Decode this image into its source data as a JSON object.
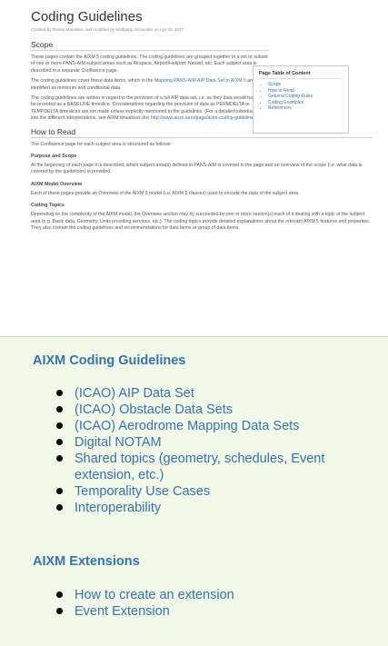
{
  "thumbnail": {
    "title": "Coding Guidelines",
    "meta": "Created by Rainer Mannsen, last modified by Wolfgang Schneider on Apr 26, 2017",
    "scope_heading": "Scope",
    "scope_p1": "These pages contain the AIXM 5 coding guidelines. The coding guidelines are grouped together in a set or subset of one or more PANS-AIM subject areas such as Airspace, Airport/Heliport, Navaid, etc. Each subject area is described in a separate Confluence page.",
    "scope_p2_pre": "The coding guidelines cover these data items, which in the ",
    "scope_p2_link": "Mapping PANS-AIM AIP Data Set to AIXM 5",
    "scope_p2_post": " are identified as minimum and conditional data.",
    "scope_p3_pre": "The coding guidelines are written in regard to the provision of a full AIP data set, i.e. as they data would have to be provided as a BASELINE timeslice. Considerations regarding the provision of data as PERMDELTA or TEMPDELTA timeslices are not made unless explicitly mentioned in the guidelines. (For a detailed introduction into the different interpretations, see AIXM timeslices doc ",
    "scope_p3_link": "http://www.aixm.aero/page/aixm-coding-guidelines",
    "scope_p3_post": ")",
    "howto_heading": "How to Read",
    "howto_p1": "The Confluence page for each subject area is structured as follows:",
    "purpose_heading": "Purpose and Scope",
    "purpose_p": "At the beginning of each page it is described, which subject area(s) defined in PANS-AIM is covered in the page and an overview of the scope (i.e. what data is covered by the guidelines) is provided.",
    "model_heading": "AIXM Model Overview",
    "model_p": "Each of these pages provide an Overview of the AIXM 5 model (i.e. AIXM 5 classes) used to encode the data of the subject area.",
    "topics_heading": "Coding Topics",
    "topics_p": "Depending on the complexity of the AIXM model, the Overview section may by succeeded by one or more section(s) each of it dealing with a topic of the subject area (e.g. Basic data, Geometry, Units providing services, etc.). The coding topics provide detailed explanations about the relevant AIXM 5 features and properties. They also contain the coding guidelines and recommendations for data items or group of data items.",
    "toc": {
      "title": "Page Table of Content",
      "items": [
        "Scope",
        "How to Read",
        "General Coding Rules",
        "Coding Examples",
        "References"
      ]
    }
  },
  "panel": {
    "heading1": "AIXM Coding Guidelines",
    "list1": [
      "(ICAO) AIP Data Set",
      "(ICAO) Obstacle Data Sets",
      "(ICAO) Aerodrome Mapping Data Sets",
      "Digital NOTAM",
      "Shared topics (geometry, schedules, Event extension, etc.)",
      "Temporality Use Cases",
      "Interoperability"
    ],
    "heading2": "AIXM Extensions",
    "list2": [
      "How to create an extension",
      "Event Extension"
    ]
  },
  "colors": {
    "link": "#3572b0",
    "panel_bg": "#f2f9e9",
    "panel_border": "#c9dfb2"
  }
}
